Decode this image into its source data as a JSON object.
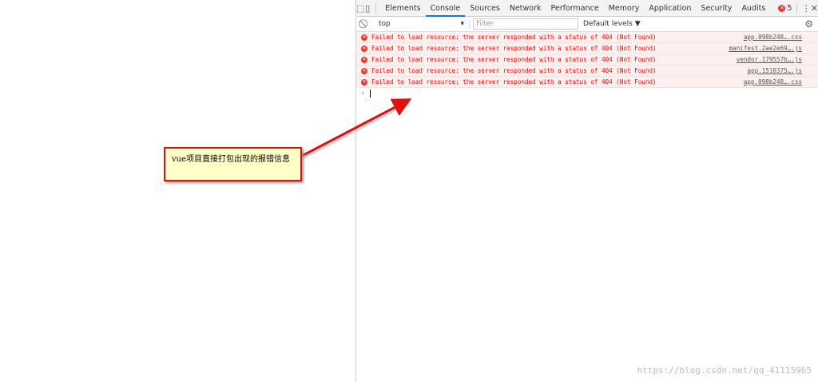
{
  "devtools": {
    "tabs": [
      "Elements",
      "Console",
      "Sources",
      "Network",
      "Performance",
      "Memory",
      "Application",
      "Security",
      "Audits"
    ],
    "active_tab": "Console",
    "error_count": "5",
    "context": "top",
    "filter_placeholder": "Filter",
    "levels": "Default levels ▼",
    "messages": [
      {
        "text": "Failed to load resource: the server responded with a status of 404 (Not Found)",
        "source": "app.098b248….css"
      },
      {
        "text": "Failed to load resource: the server responded with a status of 404 (Not Found)",
        "source": "manifest.2ae2e69….js"
      },
      {
        "text": "Failed to load resource: the server responded with a status of 404 (Not Found)",
        "source": "vendor.179557b….js"
      },
      {
        "text": "Failed to load resource: the server responded with a status of 404 (Not Found)",
        "source": "app.1510375….js"
      },
      {
        "text": "Failed to load resource: the server responded with a status of 404 (Not Found)",
        "source": "app.098b248….css"
      }
    ],
    "error_color": "#ff0000"
  },
  "annotation": {
    "text": "vue项目直接打包出现的报错信息"
  },
  "watermark": "https://blog.csdn.net/qq_41115965"
}
